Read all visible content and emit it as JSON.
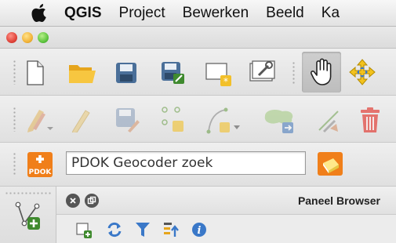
{
  "menubar": {
    "app_name": "QGIS",
    "items": [
      "Project",
      "Bewerken",
      "Beeld",
      "Ka"
    ]
  },
  "toolbar_file": {
    "buttons": [
      "new-project-icon",
      "open-project-icon",
      "save-project-icon",
      "save-as-icon",
      "new-print-composer-icon",
      "composer-manager-icon",
      "pan-hand-icon",
      "pan-to-selection-icon"
    ]
  },
  "toolbar_digitize": {
    "buttons": [
      "current-edits-icon",
      "toggle-editing-icon",
      "save-layer-edits-icon",
      "add-feature-icon",
      "node-tool-icon",
      "move-feature-icon",
      "delete-selected-icon"
    ]
  },
  "pdok": {
    "placeholder": "PDOK Geocoder zoek",
    "logo_label": "PDOK"
  },
  "panel": {
    "title": "Paneel Browser"
  },
  "colors": {
    "pan_active_bg": "#c6c6c6",
    "trash_red": "#e2423a",
    "pdok_orange": "#f07f1a"
  }
}
